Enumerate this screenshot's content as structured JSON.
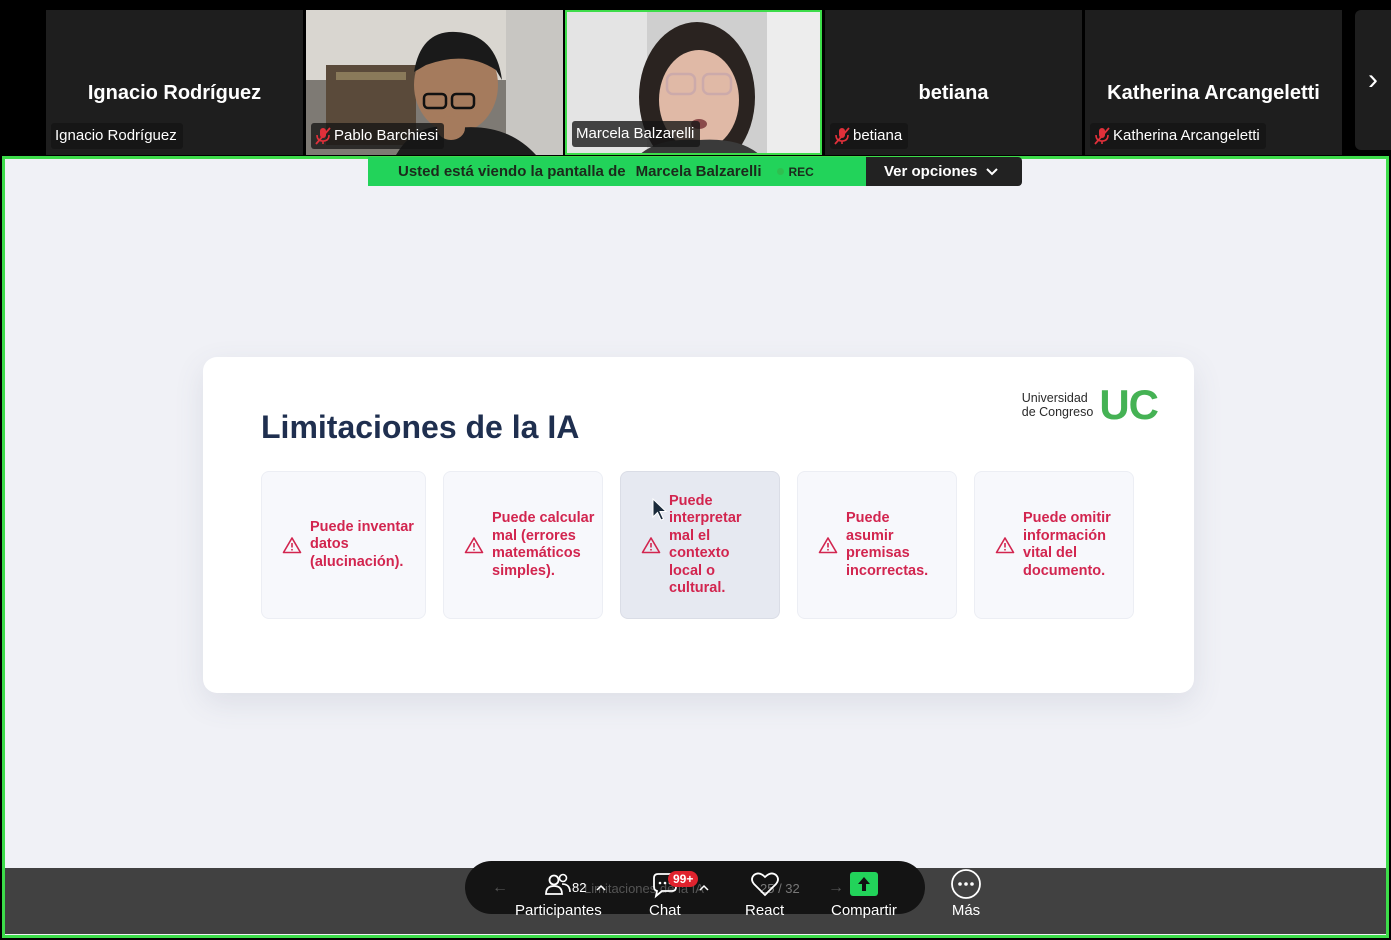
{
  "participants": [
    {
      "big_name": "Ignacio Rodríguez",
      "tag": "Ignacio Rodríguez",
      "muted": false,
      "video": false
    },
    {
      "big_name": "",
      "tag": "Pablo Barchiesi",
      "muted": true,
      "video": true
    },
    {
      "big_name": "",
      "tag": "Marcela Balzarelli",
      "muted": false,
      "video": true,
      "active": true
    },
    {
      "big_name": "betiana",
      "tag": "betiana",
      "muted": true,
      "video": false
    },
    {
      "big_name": "Katherina Arcangeletti",
      "tag": "Katherina Arcangeletti",
      "muted": true,
      "video": false
    }
  ],
  "share_banner": {
    "text_prefix": "Usted está viendo la pantalla de",
    "presenter": "Marcela Balzarelli",
    "rec": "REC",
    "options": "Ver opciones"
  },
  "slide": {
    "title": "Limitaciones de la IA",
    "logo_line1": "Universidad",
    "logo_line2": "de Congreso",
    "logo_mark": "UC",
    "items": [
      "Puede inventar datos (alucinación).",
      "Puede calcular mal (errores matemáticos simples).",
      "Puede interpretar mal el contexto local o cultural.",
      "Puede asumir premisas incorrectas.",
      "Puede omitir información vital del documento."
    ]
  },
  "toolbar": {
    "participants_label": "Participantes",
    "participants_count": "82",
    "chat_label": "Chat",
    "chat_badge": "99+",
    "react_label": "React",
    "share_label": "Compartir",
    "more_label": "Más",
    "page_indicator": "25 / 32",
    "slide_caption": "Limitaciones de la IA"
  },
  "colors": {
    "active_border": "#3ddc4a",
    "banner_green": "#22d35a",
    "title_navy": "#1f2f4f",
    "item_red": "#d2254f",
    "logo_green": "#45b254"
  }
}
